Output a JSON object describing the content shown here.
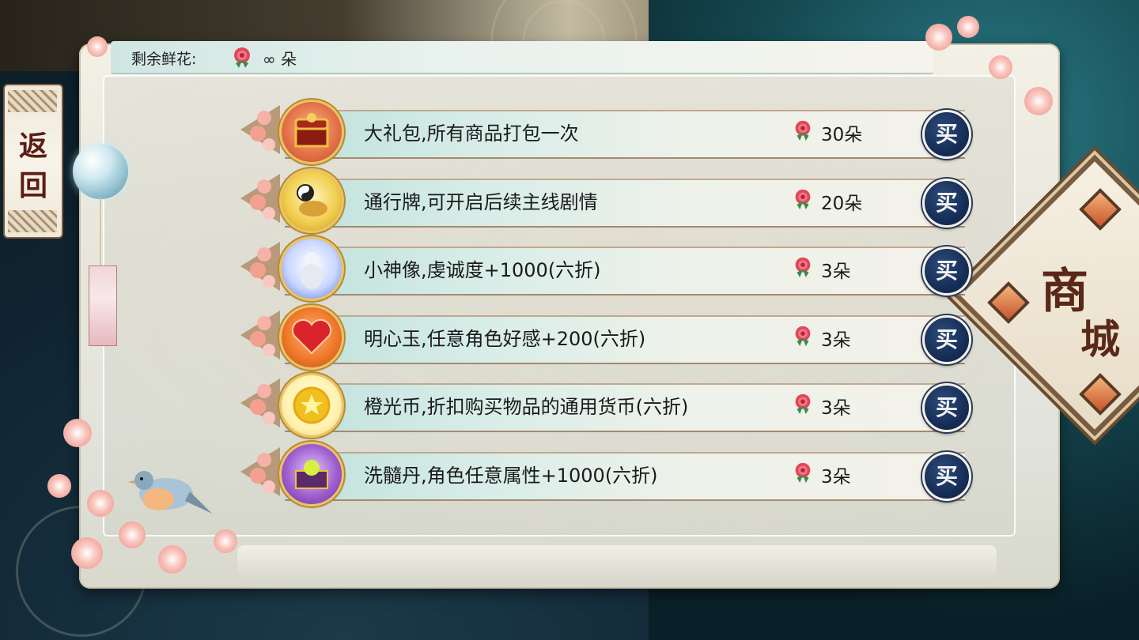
{
  "header": {
    "remaining_label": "剩余鲜花:",
    "remaining_value": "∞ 朵",
    "currency_icon": "rose-icon"
  },
  "back_button": {
    "label_line1": "返",
    "label_line2": "回"
  },
  "mall_badge": {
    "line1": "商",
    "line2": "城"
  },
  "items": [
    {
      "name": "大礼包,所有商品打包一次",
      "price": "30朵",
      "icon": "treasure-chest-icon",
      "buy_label": "买"
    },
    {
      "name": "通行牌,可开启后续主线剧情",
      "price": "20朵",
      "icon": "yin-yang-token-icon",
      "buy_label": "买"
    },
    {
      "name": "小神像,虔诚度+1000(六折)",
      "price": "3朵",
      "icon": "statue-icon",
      "buy_label": "买"
    },
    {
      "name": "明心玉,任意角色好感+200(六折)",
      "price": "3朵",
      "icon": "heart-jade-icon",
      "buy_label": "买"
    },
    {
      "name": "橙光币,折扣购买物品的通用货币(六折)",
      "price": "3朵",
      "icon": "star-coin-icon",
      "buy_label": "买"
    },
    {
      "name": "洗髓丹,角色任意属性+1000(六折)",
      "price": "3朵",
      "icon": "elixir-box-icon",
      "buy_label": "买"
    }
  ],
  "colors": {
    "buy_button": "#132a52",
    "price_rose": "#d8324a",
    "panel": "#ecebe3",
    "accent_gold": "#e9c46a"
  }
}
